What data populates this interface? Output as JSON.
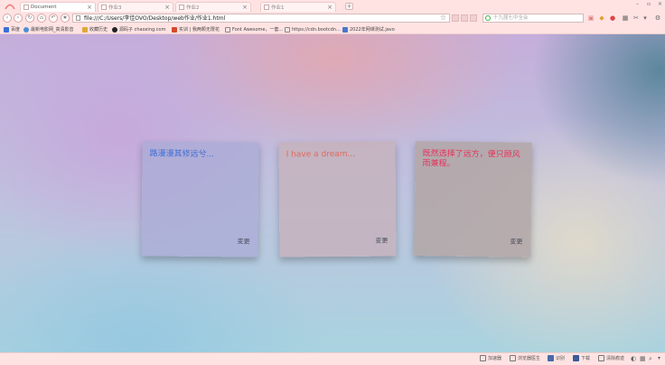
{
  "tabs": [
    {
      "label": "Document",
      "close": "×"
    },
    {
      "label": "作业3",
      "close": "×"
    },
    {
      "label": "作业2",
      "close": "×"
    },
    {
      "label": "作业1",
      "close": "×"
    }
  ],
  "new_tab": "+",
  "window_controls": [
    "–",
    "▫",
    "×"
  ],
  "toolbar": {
    "url": "file:///C:/Users/李佳OVO/Desktop/web作业/作业1.html",
    "search_placeholder": "十九届七中全会"
  },
  "bookmarks": [
    {
      "label": "百度",
      "color": "#3b6fd8"
    },
    {
      "label": "最新电影网_高清影音",
      "color": "#4a90d9"
    },
    {
      "label": "收藏历史",
      "color": "#e0a838"
    },
    {
      "label": "源码子 chaoxing.com",
      "color": "#222222"
    },
    {
      "label": "实训 | 我两颗无限花",
      "color": "#d44a2a"
    },
    {
      "label": "Font Awesome，一套...",
      "color": "#888888"
    },
    {
      "label": "https://cdn.bootcdn...",
      "color": "#888888"
    },
    {
      "label": "2022年网课测试.javo",
      "color": "#4a78c8"
    }
  ],
  "cards": [
    {
      "text": "路漫漫其修远兮...",
      "button": "变更"
    },
    {
      "text": "I have a dream...",
      "button": "变更"
    },
    {
      "text": "既然选择了远方，便只顾风雨兼程。",
      "button": "变更"
    }
  ],
  "status": [
    {
      "label": "加速器"
    },
    {
      "label": "浏览器医生"
    },
    {
      "label": "识别"
    },
    {
      "label": "下载"
    },
    {
      "label": "清除痕迹"
    }
  ],
  "colors": {
    "chrome": "#ffe3e3",
    "card1_text": "#3f6fd4",
    "card2_text": "#e06a5e",
    "card3_text": "#e8325a"
  }
}
